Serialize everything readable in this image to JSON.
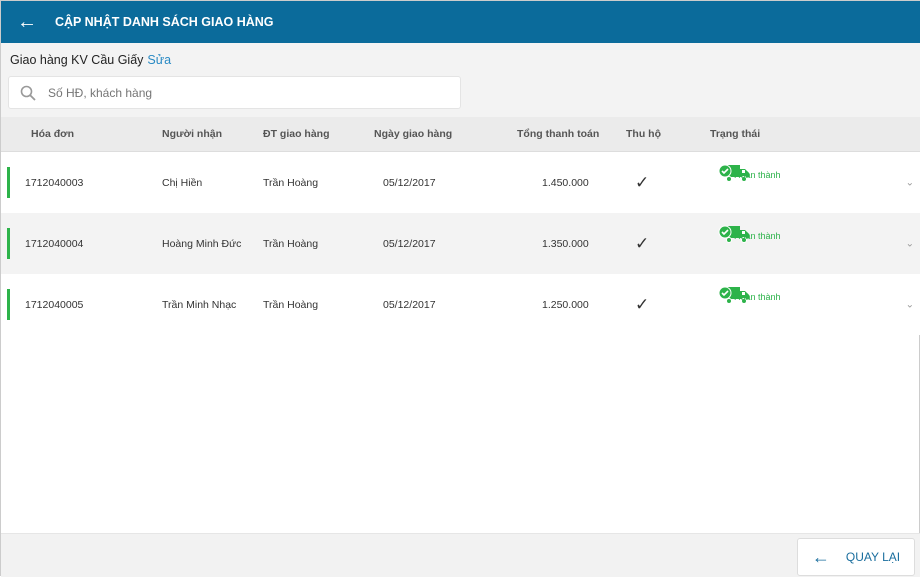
{
  "header": {
    "title": "CẬP NHẬT DANH SÁCH GIAO HÀNG",
    "back_icon": "arrow-left-icon",
    "color": "#0b6b9b"
  },
  "area": {
    "label": "Giao hàng KV Cầu Giấy",
    "edit": "Sửa"
  },
  "search": {
    "placeholder": "Số HĐ, khách hàng",
    "value": ""
  },
  "columns": [
    "Hóa đơn",
    "Người nhận",
    "ĐT giao hàng",
    "Ngày giao hàng",
    "Tổng thanh toán",
    "Thu hộ",
    "Trạng thái"
  ],
  "rows": [
    {
      "invoice": "1712040003",
      "recipient": "Chị Hiền",
      "shipper": "Trần Hoàng",
      "date": "05/12/2017",
      "total": "1.450.000",
      "collected": "✓",
      "status": "Hoàn thành"
    },
    {
      "invoice": "1712040004",
      "recipient": "Hoàng Minh Đức",
      "shipper": "Trần Hoàng",
      "date": "05/12/2017",
      "total": "1.350.000",
      "collected": "✓",
      "status": "Hoàn thành"
    },
    {
      "invoice": "1712040005",
      "recipient": "Trần Minh Nhạc",
      "shipper": "Trần Hoàng",
      "date": "05/12/2017",
      "total": "1.250.000",
      "collected": "✓",
      "status": "Hoàn thành"
    }
  ],
  "status_color": "#2db34a",
  "footer": {
    "back_label": "QUAY LẠI"
  }
}
